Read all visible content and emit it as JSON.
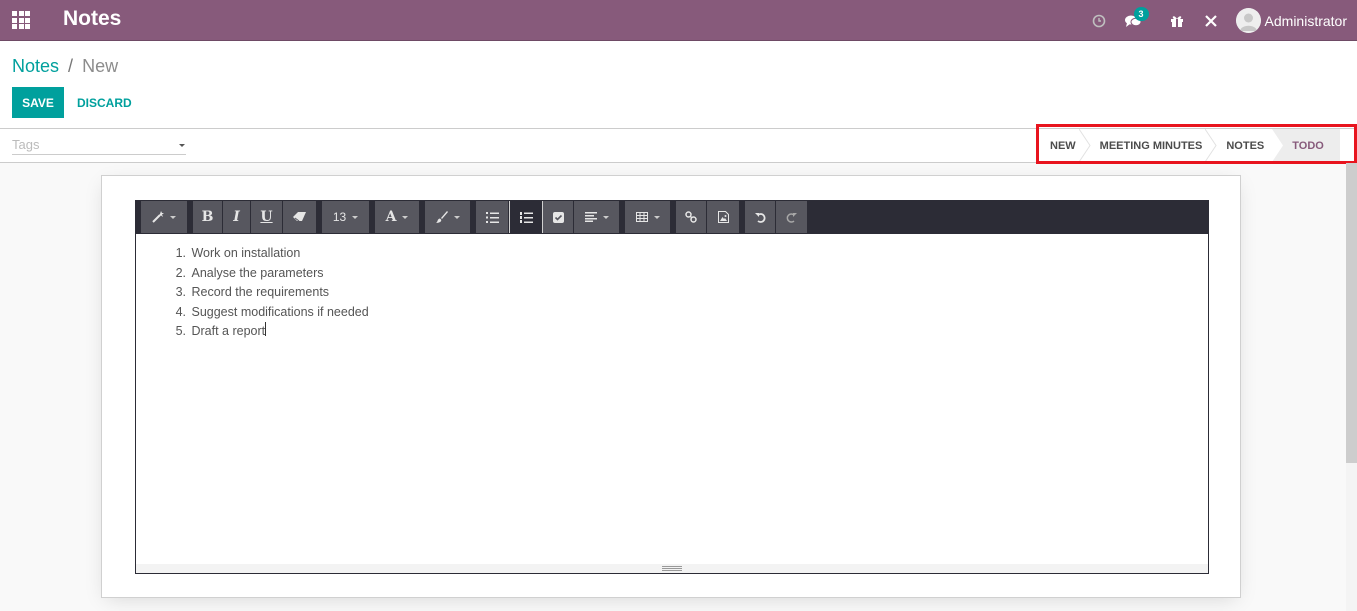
{
  "navbar": {
    "app_title": "Notes",
    "activity_icon": "clock-icon",
    "messages_icon": "chat-icon",
    "messages_count": "3",
    "gift_icon": "gift-icon",
    "debug_icon": "tools-icon",
    "user_name": "Administrator",
    "brand_color": "#875a7b"
  },
  "breadcrumb": {
    "parent": "Notes",
    "separator": "/",
    "current": "New"
  },
  "actions": {
    "save_label": "SAVE",
    "discard_label": "DISCARD",
    "accent_color": "#00a09d"
  },
  "form": {
    "tags_placeholder": "Tags",
    "stages": [
      {
        "label": "NEW",
        "active": false
      },
      {
        "label": "MEETING MINUTES",
        "active": false
      },
      {
        "label": "NOTES",
        "active": false
      },
      {
        "label": "TODO",
        "active": true
      }
    ]
  },
  "editor": {
    "font_size": "13",
    "toolbar": {
      "style": "magic-wand-icon",
      "bold": "B",
      "italic": "I",
      "underline": "U",
      "eraser": "eraser-icon",
      "color": "A",
      "brush": "paintbrush-icon",
      "ul": "unordered-list-icon",
      "ol": "ordered-list-icon",
      "checklist": "checkbox-icon",
      "align": "align-icon",
      "table": "table-icon",
      "link": "link-icon",
      "image": "image-icon",
      "undo": "undo-icon",
      "redo": "redo-icon"
    },
    "list_items": [
      {
        "num": "1.",
        "text": "Work on installation"
      },
      {
        "num": "2.",
        "text": "Analyse the parameters"
      },
      {
        "num": "3.",
        "text": "Record the requirements"
      },
      {
        "num": "4.",
        "text": "Suggest modifications if needed"
      },
      {
        "num": "5.",
        "text": "Draft a report"
      }
    ]
  }
}
